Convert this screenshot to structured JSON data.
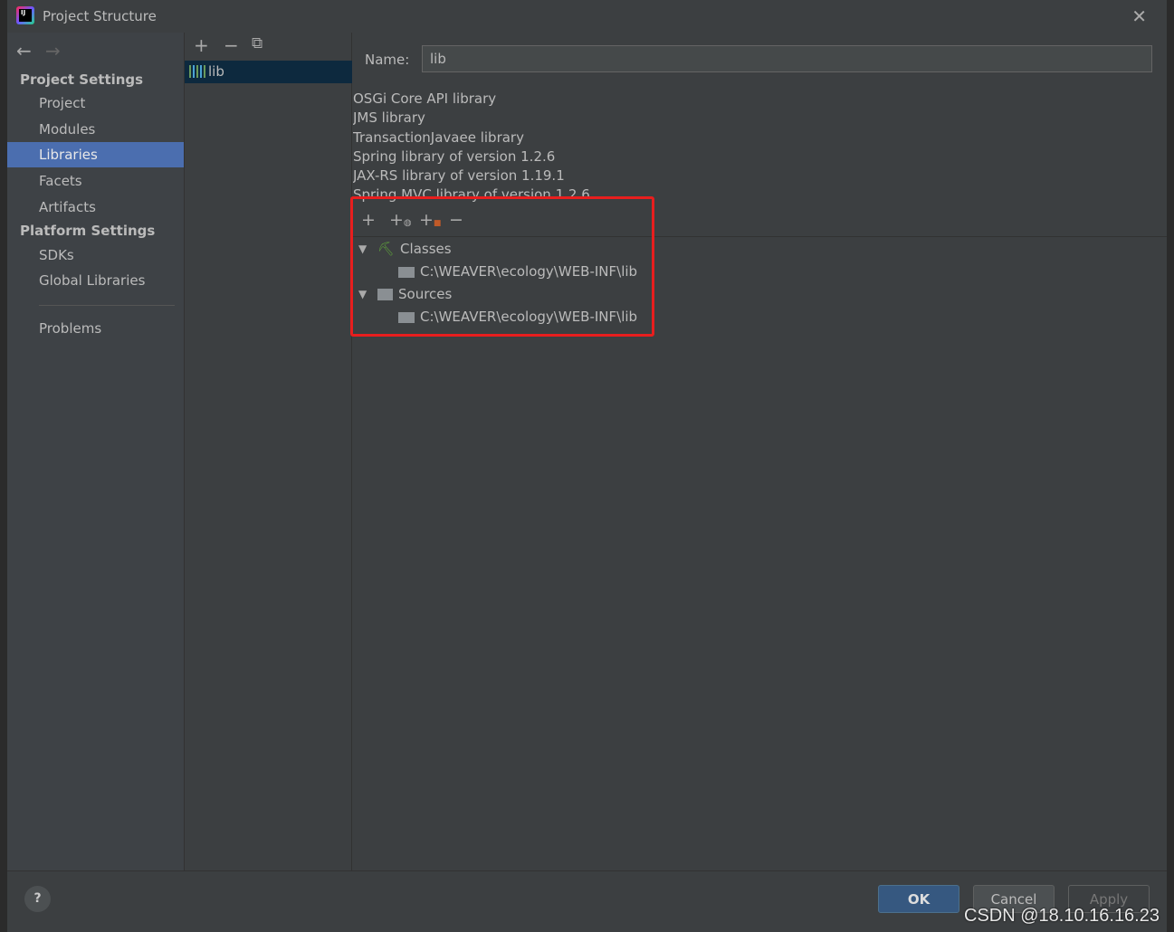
{
  "window": {
    "title": "Project Structure"
  },
  "sidebar": {
    "project_settings": "Project Settings",
    "items": [
      {
        "label": "Project"
      },
      {
        "label": "Modules"
      },
      {
        "label": "Libraries"
      },
      {
        "label": "Facets"
      },
      {
        "label": "Artifacts"
      }
    ],
    "platform_settings": "Platform Settings",
    "platform_items": [
      {
        "label": "SDKs"
      },
      {
        "label": "Global Libraries"
      }
    ],
    "problems": "Problems",
    "selected": "Libraries"
  },
  "libraries": {
    "items": [
      {
        "label": "lib"
      }
    ]
  },
  "detail": {
    "name_label": "Name:",
    "name_value": "lib",
    "kinds": [
      "OSGi Core API library",
      "JMS library",
      "TransactionJavaee library",
      "Spring library of version 1.2.6",
      "JAX-RS library of version 1.19.1",
      "Spring MVC library of version 1.2.6"
    ],
    "tree": {
      "classes": "Classes",
      "classes_path": "C:\\WEAVER\\ecology\\WEB-INF\\lib",
      "sources": "Sources",
      "sources_path": "C:\\WEAVER\\ecology\\WEB-INF\\lib"
    },
    "highlight_color": "#e81e1e"
  },
  "footer": {
    "help": "?",
    "ok": "OK",
    "cancel": "Cancel",
    "apply": "Apply"
  },
  "watermark": "CSDN @18.10.16.16.23"
}
